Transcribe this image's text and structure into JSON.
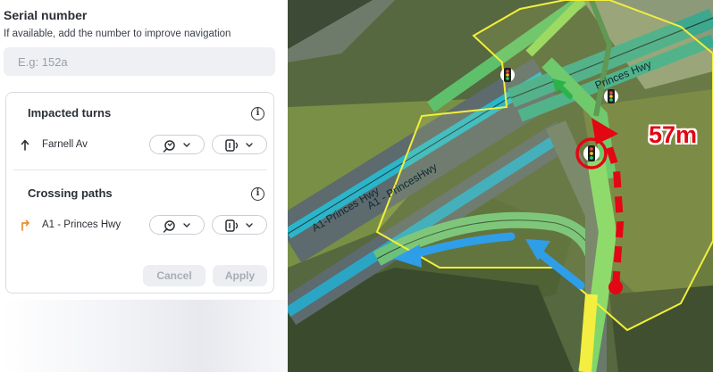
{
  "form": {
    "title": "Serial number",
    "subtitle": "If available, add the number to improve navigation",
    "serial_placeholder": "E.g: 152a",
    "serial_value": ""
  },
  "impacted_turns": {
    "title": "Impacted turns",
    "rows": [
      {
        "label": "Farnell Av",
        "direction_icon": "arrow-up-icon"
      }
    ]
  },
  "crossing_paths": {
    "title": "Crossing paths",
    "rows": [
      {
        "label": "A1 - Princes Hwy",
        "direction_icon": "turn-right-arrow-icon",
        "icon_color": "#f08c2e"
      }
    ]
  },
  "actions": {
    "cancel_label": "Cancel",
    "apply_label": "Apply"
  },
  "map": {
    "distance_label": "57m",
    "road_labels": [
      "A1-Princes Hwy",
      "A1 - PrincesHwy",
      "Princes Hwy"
    ],
    "colors": {
      "route": "#e30613",
      "arrow": "#29a3e8",
      "green_arrow": "#2bb34a",
      "zone": "#f2ef3a"
    }
  }
}
